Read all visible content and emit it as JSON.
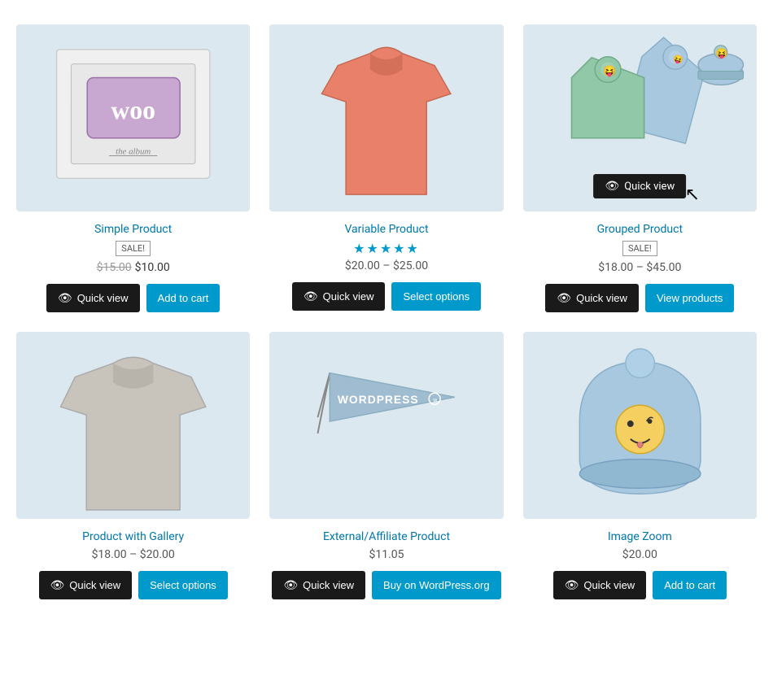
{
  "products": [
    {
      "id": "simple-product",
      "name": "Simple Product",
      "badge": "SALE!",
      "stars": null,
      "price_original": "$15.00",
      "price_sale": "$10.00",
      "price_range": null,
      "buttons": [
        {
          "label": "Quick view",
          "type": "dark",
          "icon": "eye"
        },
        {
          "label": "Add to cart",
          "type": "blue"
        }
      ],
      "has_overlay": false,
      "image_type": "woo-album"
    },
    {
      "id": "variable-product",
      "name": "Variable Product",
      "badge": null,
      "stars": "★★★★★",
      "price_original": null,
      "price_sale": null,
      "price_range": "$20.00 – $25.00",
      "buttons": [
        {
          "label": "Quick view",
          "type": "dark",
          "icon": "eye"
        },
        {
          "label": "Select options",
          "type": "blue"
        }
      ],
      "has_overlay": false,
      "image_type": "tshirt-orange"
    },
    {
      "id": "grouped-product",
      "name": "Grouped Product",
      "badge": "SALE!",
      "stars": null,
      "price_original": null,
      "price_sale": null,
      "price_range": "$18.00 – $45.00",
      "buttons": [
        {
          "label": "Quick view",
          "type": "dark",
          "icon": "eye"
        },
        {
          "label": "View products",
          "type": "blue"
        }
      ],
      "has_overlay": true,
      "image_type": "hoodies"
    },
    {
      "id": "product-gallery",
      "name": "Product with Gallery",
      "badge": null,
      "stars": null,
      "price_original": null,
      "price_sale": null,
      "price_range": "$18.00 – $20.00",
      "buttons": [
        {
          "label": "Quick view",
          "type": "dark",
          "icon": "eye"
        },
        {
          "label": "Select options",
          "type": "blue"
        }
      ],
      "has_overlay": false,
      "image_type": "tshirt-gray"
    },
    {
      "id": "external-product",
      "name": "External/Affiliate Product",
      "badge": null,
      "stars": null,
      "price_original": null,
      "price_sale": null,
      "price_range": "$11.05",
      "buttons": [
        {
          "label": "Quick view",
          "type": "dark",
          "icon": "eye"
        },
        {
          "label": "Buy on WordPress.org",
          "type": "blue"
        }
      ],
      "has_overlay": false,
      "image_type": "wordpress-flag"
    },
    {
      "id": "image-zoom",
      "name": "Image Zoom",
      "badge": null,
      "stars": null,
      "price_original": null,
      "price_sale": null,
      "price_range": "$20.00",
      "buttons": [
        {
          "label": "Quick view",
          "type": "dark",
          "icon": "eye"
        },
        {
          "label": "Add to cart",
          "type": "blue"
        }
      ],
      "has_overlay": false,
      "image_type": "beanie"
    }
  ]
}
